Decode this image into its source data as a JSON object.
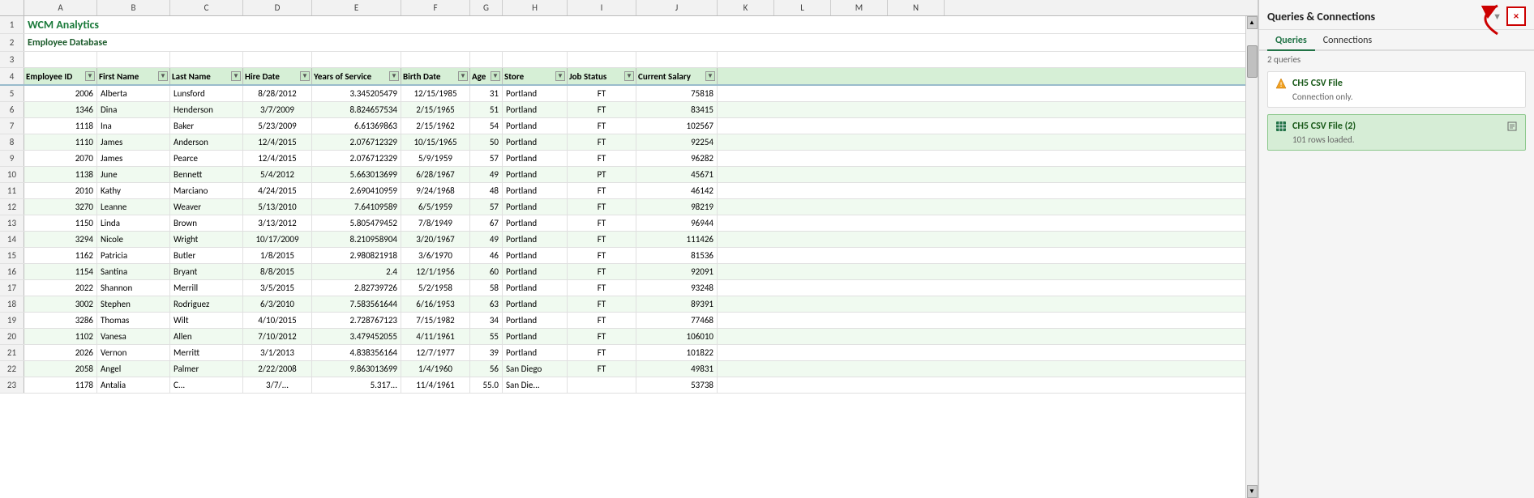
{
  "app": {
    "title": "WCM Analytics",
    "subtitle": "Employee Database"
  },
  "panel": {
    "title": "Queries & Connections",
    "close_label": "×",
    "tabs": [
      "Queries",
      "Connections"
    ],
    "active_tab": "Queries",
    "count_label": "2 queries",
    "queries": [
      {
        "name": "CH5 CSV File",
        "subtitle": "Connection only.",
        "active": false,
        "icon": "warning"
      },
      {
        "name": "CH5 CSV File (2)",
        "subtitle": "101 rows loaded.",
        "active": true,
        "icon": "table"
      }
    ]
  },
  "columns": {
    "letters": [
      "A",
      "B",
      "C",
      "D",
      "E",
      "F",
      "G",
      "H",
      "I",
      "J",
      "K",
      "L",
      "M",
      "N"
    ],
    "headers": [
      "Employee ID",
      "First Name",
      "Last Name",
      "Hire Date",
      "Years of Service",
      "Birth Date",
      "Age",
      "Store",
      "Job Status",
      "Current Salary"
    ]
  },
  "rows": [
    {
      "num": "1",
      "empid": "",
      "fname": "WCM Analytics",
      "lname": "",
      "hdate": "",
      "yos": "",
      "bdate": "",
      "age": "",
      "store": "",
      "jstatus": "",
      "salary": "",
      "type": "title1"
    },
    {
      "num": "2",
      "empid": "",
      "fname": "Employee Database",
      "lname": "",
      "hdate": "",
      "yos": "",
      "bdate": "",
      "age": "",
      "store": "",
      "jstatus": "",
      "salary": "",
      "type": "title2"
    },
    {
      "num": "3",
      "empid": "",
      "fname": "",
      "lname": "",
      "hdate": "",
      "yos": "",
      "bdate": "",
      "age": "",
      "store": "",
      "jstatus": "",
      "salary": "",
      "type": "empty"
    },
    {
      "num": "4",
      "empid": "Employee ID",
      "fname": "First Name",
      "lname": "Last Name",
      "hdate": "Hire Date",
      "yos": "Years of Service",
      "bdate": "Birth Date",
      "age": "Age",
      "store": "Store",
      "jstatus": "Job Status",
      "salary": "Current Salary",
      "type": "header"
    },
    {
      "num": "5",
      "empid": "2006",
      "fname": "Alberta",
      "lname": "Lunsford",
      "hdate": "8/28/2012",
      "yos": "3.345205479",
      "bdate": "12/15/1985",
      "age": "31",
      "store": "Portland",
      "jstatus": "FT",
      "salary": "75818"
    },
    {
      "num": "6",
      "empid": "1346",
      "fname": "Dina",
      "lname": "Henderson",
      "hdate": "3/7/2009",
      "yos": "8.824657534",
      "bdate": "2/15/1965",
      "age": "51",
      "store": "Portland",
      "jstatus": "FT",
      "salary": "83415"
    },
    {
      "num": "7",
      "empid": "1118",
      "fname": "Ina",
      "lname": "Baker",
      "hdate": "5/23/2009",
      "yos": "6.61369863",
      "bdate": "2/15/1962",
      "age": "54",
      "store": "Portland",
      "jstatus": "FT",
      "salary": "102567"
    },
    {
      "num": "8",
      "empid": "1110",
      "fname": "James",
      "lname": "Anderson",
      "hdate": "12/4/2015",
      "yos": "2.076712329",
      "bdate": "10/15/1965",
      "age": "50",
      "store": "Portland",
      "jstatus": "FT",
      "salary": "92254"
    },
    {
      "num": "9",
      "empid": "2070",
      "fname": "James",
      "lname": "Pearce",
      "hdate": "12/4/2015",
      "yos": "2.076712329",
      "bdate": "5/9/1959",
      "age": "57",
      "store": "Portland",
      "jstatus": "FT",
      "salary": "96282"
    },
    {
      "num": "10",
      "empid": "1138",
      "fname": "June",
      "lname": "Bennett",
      "hdate": "5/4/2012",
      "yos": "5.663013699",
      "bdate": "6/28/1967",
      "age": "49",
      "store": "Portland",
      "jstatus": "PT",
      "salary": "45671"
    },
    {
      "num": "11",
      "empid": "2010",
      "fname": "Kathy",
      "lname": "Marciano",
      "hdate": "4/24/2015",
      "yos": "2.690410959",
      "bdate": "9/24/1968",
      "age": "48",
      "store": "Portland",
      "jstatus": "FT",
      "salary": "46142"
    },
    {
      "num": "12",
      "empid": "3270",
      "fname": "Leanne",
      "lname": "Weaver",
      "hdate": "5/13/2010",
      "yos": "7.64109589",
      "bdate": "6/5/1959",
      "age": "57",
      "store": "Portland",
      "jstatus": "FT",
      "salary": "98219"
    },
    {
      "num": "13",
      "empid": "1150",
      "fname": "Linda",
      "lname": "Brown",
      "hdate": "3/13/2012",
      "yos": "5.805479452",
      "bdate": "7/8/1949",
      "age": "67",
      "store": "Portland",
      "jstatus": "FT",
      "salary": "96944"
    },
    {
      "num": "14",
      "empid": "3294",
      "fname": "Nicole",
      "lname": "Wright",
      "hdate": "10/17/2009",
      "yos": "8.210958904",
      "bdate": "3/20/1967",
      "age": "49",
      "store": "Portland",
      "jstatus": "FT",
      "salary": "111426"
    },
    {
      "num": "15",
      "empid": "1162",
      "fname": "Patricia",
      "lname": "Butler",
      "hdate": "1/8/2015",
      "yos": "2.980821918",
      "bdate": "3/6/1970",
      "age": "46",
      "store": "Portland",
      "jstatus": "FT",
      "salary": "81536"
    },
    {
      "num": "16",
      "empid": "1154",
      "fname": "Santina",
      "lname": "Bryant",
      "hdate": "8/8/2015",
      "yos": "2.4",
      "bdate": "12/1/1956",
      "age": "60",
      "store": "Portland",
      "jstatus": "FT",
      "salary": "92091"
    },
    {
      "num": "17",
      "empid": "2022",
      "fname": "Shannon",
      "lname": "Merrill",
      "hdate": "3/5/2015",
      "yos": "2.82739726",
      "bdate": "5/2/1958",
      "age": "58",
      "store": "Portland",
      "jstatus": "FT",
      "salary": "93248"
    },
    {
      "num": "18",
      "empid": "3002",
      "fname": "Stephen",
      "lname": "Rodriguez",
      "hdate": "6/3/2010",
      "yos": "7.583561644",
      "bdate": "6/16/1953",
      "age": "63",
      "store": "Portland",
      "jstatus": "FT",
      "salary": "89391"
    },
    {
      "num": "19",
      "empid": "3286",
      "fname": "Thomas",
      "lname": "Wilt",
      "hdate": "4/10/2015",
      "yos": "2.728767123",
      "bdate": "7/15/1982",
      "age": "34",
      "store": "Portland",
      "jstatus": "FT",
      "salary": "77468"
    },
    {
      "num": "20",
      "empid": "1102",
      "fname": "Vanesa",
      "lname": "Allen",
      "hdate": "7/10/2012",
      "yos": "3.479452055",
      "bdate": "4/11/1961",
      "age": "55",
      "store": "Portland",
      "jstatus": "FT",
      "salary": "106010"
    },
    {
      "num": "21",
      "empid": "2026",
      "fname": "Vernon",
      "lname": "Merritt",
      "hdate": "3/1/2013",
      "yos": "4.838356164",
      "bdate": "12/7/1977",
      "age": "39",
      "store": "Portland",
      "jstatus": "FT",
      "salary": "101822"
    },
    {
      "num": "22",
      "empid": "2058",
      "fname": "Angel",
      "lname": "Palmer",
      "hdate": "2/22/2008",
      "yos": "9.863013699",
      "bdate": "1/4/1960",
      "age": "56",
      "store": "San Diego",
      "jstatus": "FT",
      "salary": "49831"
    },
    {
      "num": "23",
      "empid": "1178",
      "fname": "Antalia",
      "lname": "C...",
      "hdate": "3/7/...",
      "yos": "5.317...",
      "bdate": "11/4/1961",
      "age": "55.0",
      "store": "San Die...",
      "jstatus": "",
      "salary": "53738"
    }
  ]
}
